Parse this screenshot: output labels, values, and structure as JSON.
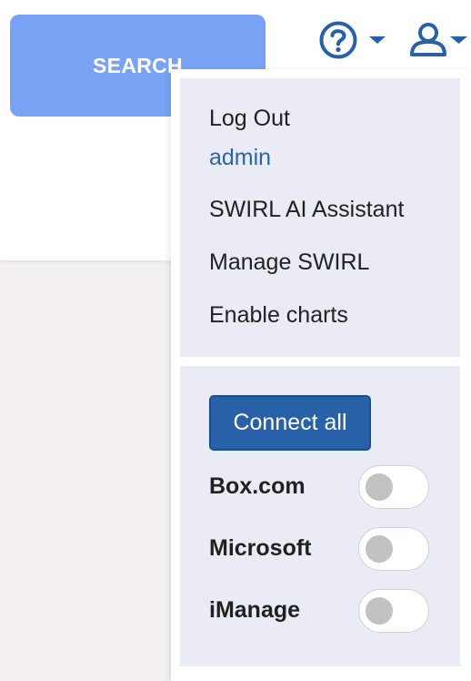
{
  "search": {
    "label": "SEARCH"
  },
  "header": {
    "help_icon": "question-circle-icon",
    "user_icon": "user-icon"
  },
  "user_menu": {
    "items": [
      {
        "label": "Log Out"
      },
      {
        "label": "admin"
      },
      {
        "label": "SWIRL AI Assistant"
      },
      {
        "label": "Manage SWIRL"
      },
      {
        "label": "Enable charts"
      }
    ]
  },
  "connect": {
    "connect_all_label": "Connect all",
    "services": [
      {
        "label": "Box.com",
        "enabled": false
      },
      {
        "label": "Microsoft",
        "enabled": false
      },
      {
        "label": "iManage",
        "enabled": false
      }
    ]
  },
  "colors": {
    "accent": "#2861a8",
    "search_button": "#79a1f4",
    "user_link": "#2c64a8",
    "menu_bg": "#e9ecf4"
  }
}
